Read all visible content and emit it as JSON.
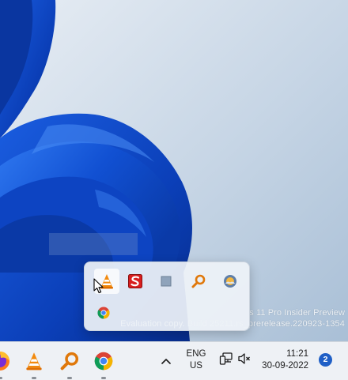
{
  "watermark": {
    "line1": "s 11 Pro Insider Preview",
    "line2": "Evaluation copy. Build 25211.rs_prerelease.220923-1354"
  },
  "tray_flyout": {
    "icons": [
      {
        "name": "vlc-icon",
        "active": true
      },
      {
        "name": "sumatra-pdf-icon"
      },
      {
        "name": "flag-icon"
      },
      {
        "name": "search-tool-icon"
      },
      {
        "name": "weather-icon"
      },
      {
        "name": "chrome-icon"
      }
    ]
  },
  "taskbar": {
    "apps": [
      "firefox-icon",
      "vlc-icon",
      "search-tool-icon",
      "chrome-icon"
    ],
    "language": {
      "line1": "ENG",
      "line2": "US"
    },
    "clock": {
      "time": "11:21",
      "date": "30-09-2022"
    },
    "notification_count": "2"
  },
  "colors": {
    "taskbar_bg": "#eef1f5",
    "accent": "#1f5fc6",
    "wallpaper_blue": "#0b3fb8"
  }
}
